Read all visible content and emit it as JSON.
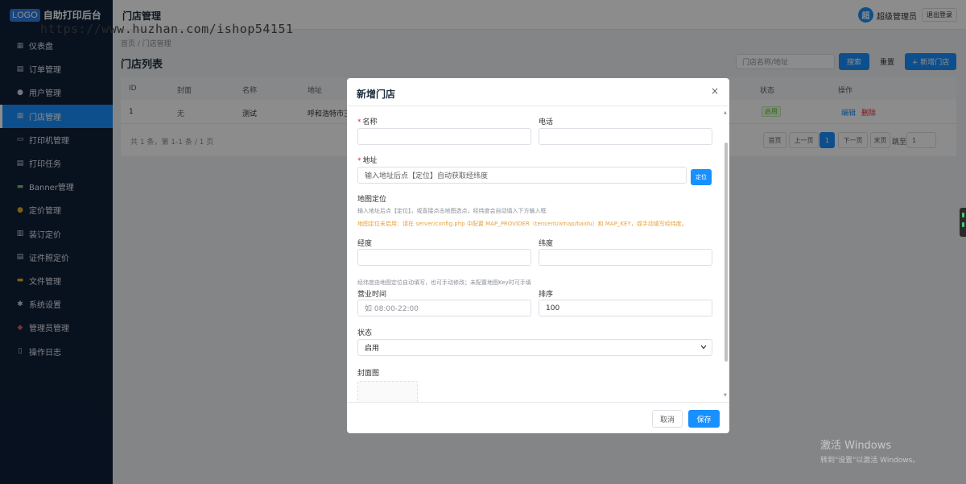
{
  "brand": {
    "logo": "LOGO",
    "title": "自助打印后台"
  },
  "watermark": "https://www.huzhan.com/ishop54151",
  "sidebar": {
    "items": [
      {
        "label": "仪表盘",
        "icon": "dashboard-icon"
      },
      {
        "label": "订单管理",
        "icon": "order-icon"
      },
      {
        "label": "用户管理",
        "icon": "user-icon"
      },
      {
        "label": "门店管理",
        "icon": "store-icon",
        "active": true
      },
      {
        "label": "打印机管理",
        "icon": "printer-icon"
      },
      {
        "label": "打印任务",
        "icon": "print-task-icon"
      },
      {
        "label": "Banner管理",
        "icon": "banner-icon"
      },
      {
        "label": "定价管理",
        "icon": "money-bag-icon"
      },
      {
        "label": "装订定价",
        "icon": "binding-icon"
      },
      {
        "label": "证件照定价",
        "icon": "id-photo-icon"
      },
      {
        "label": "文件管理",
        "icon": "folder-icon"
      },
      {
        "label": "系统设置",
        "icon": "gear-icon"
      },
      {
        "label": "管理员管理",
        "icon": "shield-icon"
      },
      {
        "label": "操作日志",
        "icon": "log-icon"
      }
    ]
  },
  "header": {
    "title": "门店管理",
    "avatar": "超",
    "user": "超级管理员",
    "logout": "退出登录"
  },
  "main": {
    "breadcrumb": "首页 / 门店管理",
    "list_title": "门店列表",
    "search_placeholder": "门店名称/地址",
    "search_button": "搜索",
    "reset_button": "重置",
    "add_button": "+ 新增门店",
    "table": {
      "columns": [
        "ID",
        "封面",
        "名称",
        "地址",
        "状态",
        "操作"
      ],
      "rows": [
        {
          "id": "1",
          "cover": "无",
          "name": "测试",
          "address": "呼和浩特市玉",
          "status": "启用",
          "edit": "编辑",
          "delete": "删除"
        }
      ]
    },
    "pagination": {
      "summary": "共 1 条，第 1-1 条 / 1 页",
      "first": "首页",
      "prev": "上一页",
      "current": "1",
      "next": "下一页",
      "last": "末页",
      "jump_label": "跳至",
      "jump_value": "1"
    }
  },
  "modal": {
    "title": "新增门店",
    "close": "×",
    "fields": {
      "name_label": "名称",
      "phone_label": "电话",
      "address_label": "地址",
      "address_placeholder": "输入地址后点【定位】自动获取经纬度",
      "locate_button": "定位",
      "map_label": "地图定位",
      "map_hint": "输入地址后点【定位】，或直接点击地图选点，经纬度会自动填入下方输入框",
      "map_warning": "地图定位未启用：请在 server/config.php 中配置 MAP_PROVIDER（tencent/amap/baidu）和 MAP_KEY，或手动填写经纬度。",
      "lng_label": "经度",
      "lat_label": "纬度",
      "coord_hint": "经纬度由地图定位自动填写，也可手动修改；未配置地图Key时可手填",
      "hours_label": "营业时间",
      "hours_placeholder": "如 08:00-22:00",
      "sort_label": "排序",
      "sort_value": "100",
      "status_label": "状态",
      "status_value": "启用",
      "cover_label": "封面图"
    },
    "cancel": "取消",
    "save": "保存"
  },
  "os": {
    "activate_title": "激活 Windows",
    "activate_hint": "转到\"设置\"以激活 Windows。"
  }
}
